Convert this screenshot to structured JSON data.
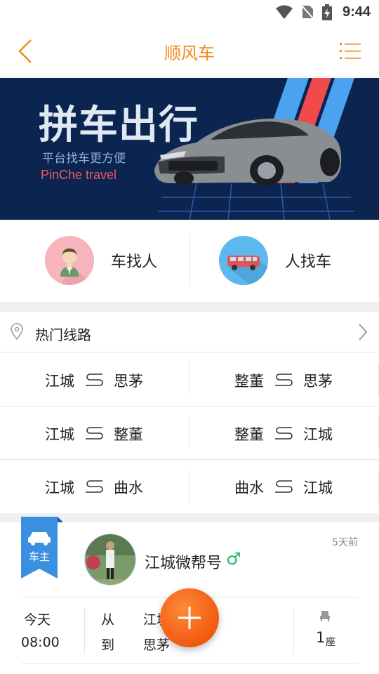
{
  "status_bar": {
    "time": "9:44"
  },
  "header": {
    "title": "顺风车"
  },
  "banner": {
    "headline": "拼车出行",
    "subtitle_cn": "平台找车更方便",
    "subtitle_en": "PinChe travel"
  },
  "quick_actions": [
    {
      "label": "车找人",
      "icon": "driver-person-icon"
    },
    {
      "label": "人找车",
      "icon": "car-icon"
    }
  ],
  "hot_routes": {
    "title": "热门线路",
    "routes": [
      {
        "from": "江城",
        "to": "思茅"
      },
      {
        "from": "整董",
        "to": "思茅"
      },
      {
        "from": "江城",
        "to": "整董"
      },
      {
        "from": "整董",
        "to": "江城"
      },
      {
        "from": "江城",
        "to": "曲水"
      },
      {
        "from": "曲水",
        "to": "江城"
      }
    ]
  },
  "card": {
    "role_tag": "车主",
    "username": "江城微帮号",
    "gender_symbol": "♂",
    "time_ago": "5天前",
    "day": "今天",
    "time": "08:00",
    "from_label": "从",
    "to_label": "到",
    "from_value": "江城",
    "to_value": "思茅",
    "seats": "1",
    "seat_unit": "座"
  },
  "colors": {
    "accent": "#f08a1c",
    "banner_bg": "#0c2450",
    "tag_blue": "#3b8fe0",
    "fab": "#f05a10",
    "gender_green": "#1fb86a"
  }
}
